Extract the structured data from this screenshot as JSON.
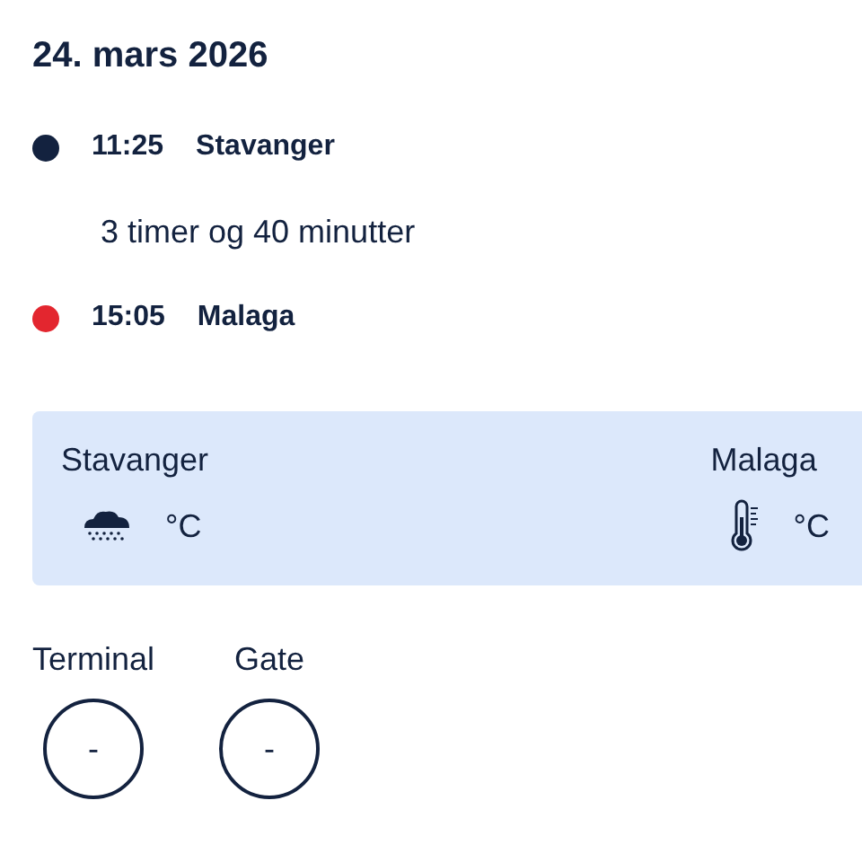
{
  "date": "24. mars 2026",
  "stops": [
    {
      "time": "11:25",
      "place": "Stavanger",
      "color": "#13223f"
    },
    {
      "time": "15:05",
      "place": "Malaga",
      "color": "#e3262f"
    }
  ],
  "duration": "3 timer og 40 minutter",
  "weather": [
    {
      "city": "Stavanger",
      "kind": "cloud",
      "unit": "°C"
    },
    {
      "city": "Malaga",
      "kind": "thermometer",
      "unit": "°C"
    }
  ],
  "info": [
    {
      "label": "Terminal",
      "value": "-"
    },
    {
      "label": "Gate",
      "value": "-"
    }
  ]
}
